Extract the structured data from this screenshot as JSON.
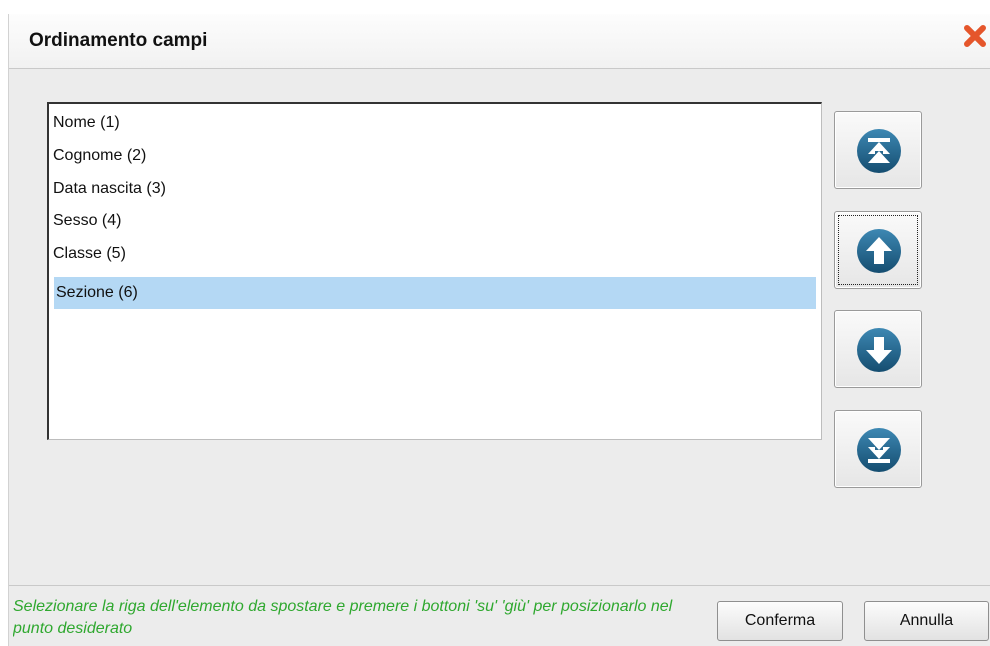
{
  "dialog": {
    "title": "Ordinamento campi",
    "close_icon": "close-icon"
  },
  "list": {
    "items": [
      {
        "label": "Nome (1)",
        "selected": false
      },
      {
        "label": "Cognome (2)",
        "selected": false
      },
      {
        "label": "Data nascita (3)",
        "selected": false
      },
      {
        "label": "Sesso (4)",
        "selected": false
      },
      {
        "label": "Classe (5)",
        "selected": false
      },
      {
        "label": "Sezione (6)",
        "selected": true
      }
    ],
    "selected_color": "#b4d8f4"
  },
  "move_buttons": [
    {
      "name": "move-to-top-button",
      "icon": "move-to-top-icon",
      "focused": false
    },
    {
      "name": "move-up-button",
      "icon": "arrow-up-icon",
      "focused": true
    },
    {
      "name": "move-down-button",
      "icon": "arrow-down-icon",
      "focused": false
    },
    {
      "name": "move-to-bottom-button",
      "icon": "move-to-bottom-icon",
      "focused": false
    }
  ],
  "footer": {
    "hint": "Selezionare la riga dell'elemento da spostare e premere i bottoni 'su' 'giù' per posizionarlo nel punto desiderato",
    "hint_color": "#2fa82f",
    "confirm_label": "Conferma",
    "cancel_label": "Annulla"
  },
  "colors": {
    "icon_blue": "#1c5f86",
    "close_red": "#e5562b"
  }
}
